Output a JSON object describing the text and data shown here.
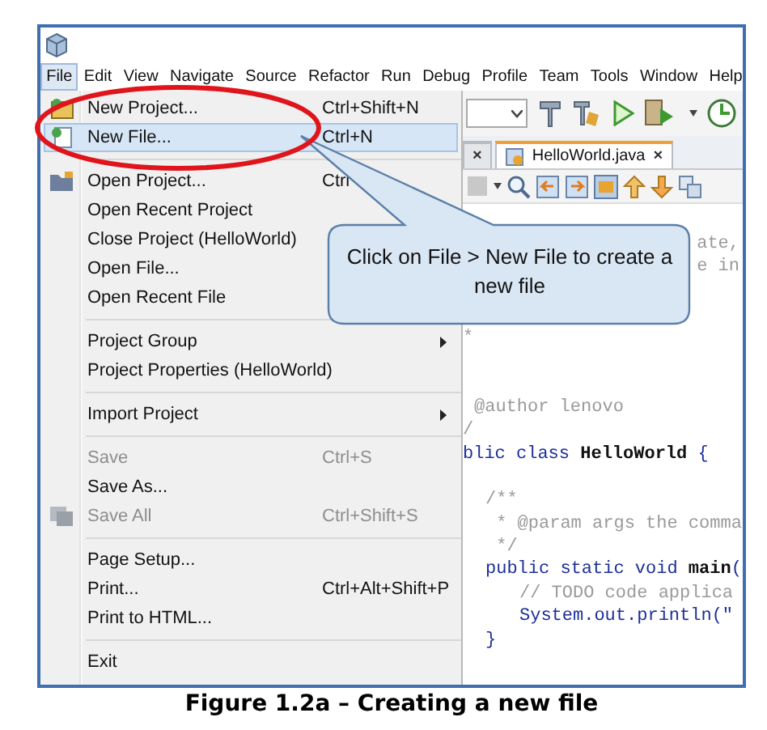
{
  "menubar": [
    {
      "label": "File",
      "selected": true
    },
    {
      "label": "Edit",
      "selected": false
    },
    {
      "label": "View",
      "selected": false
    },
    {
      "label": "Navigate",
      "selected": false
    },
    {
      "label": "Source",
      "selected": false
    },
    {
      "label": "Refactor",
      "selected": false
    },
    {
      "label": "Run",
      "selected": false
    },
    {
      "label": "Debug",
      "selected": false
    },
    {
      "label": "Profile",
      "selected": false
    },
    {
      "label": "Team",
      "selected": false
    },
    {
      "label": "Tools",
      "selected": false
    },
    {
      "label": "Window",
      "selected": false
    },
    {
      "label": "Help",
      "selected": false
    }
  ],
  "file_menu": [
    {
      "kind": "item",
      "label": "New Project...",
      "shortcut": "Ctrl+Shift+N",
      "selected": false,
      "disabled": false
    },
    {
      "kind": "item",
      "label": "New File...",
      "shortcut": "Ctrl+N",
      "selected": true,
      "disabled": false
    },
    {
      "kind": "separator"
    },
    {
      "kind": "item",
      "label": "Open Project...",
      "shortcut": "Ctrl",
      "selected": false,
      "disabled": false
    },
    {
      "kind": "item",
      "label": "Open Recent Project",
      "selected": false,
      "disabled": false
    },
    {
      "kind": "item",
      "label": "Close Project (HelloWorld)",
      "selected": false,
      "disabled": false
    },
    {
      "kind": "item",
      "label": "Open File...",
      "selected": false,
      "disabled": false
    },
    {
      "kind": "item",
      "label": "Open Recent File",
      "selected": false,
      "disabled": false
    },
    {
      "kind": "separator"
    },
    {
      "kind": "item",
      "label": "Project Group",
      "submenu": true,
      "selected": false,
      "disabled": false
    },
    {
      "kind": "item",
      "label": "Project Properties (HelloWorld)",
      "selected": false,
      "disabled": false
    },
    {
      "kind": "separator"
    },
    {
      "kind": "item",
      "label": "Import Project",
      "submenu": true,
      "selected": false,
      "disabled": false
    },
    {
      "kind": "separator"
    },
    {
      "kind": "item",
      "label": "Save",
      "shortcut": "Ctrl+S",
      "selected": false,
      "disabled": true
    },
    {
      "kind": "item",
      "label": "Save As...",
      "selected": false,
      "disabled": false
    },
    {
      "kind": "item",
      "label": "Save All",
      "shortcut": "Ctrl+Shift+S",
      "selected": false,
      "disabled": true
    },
    {
      "kind": "separator"
    },
    {
      "kind": "item",
      "label": "Page Setup...",
      "selected": false,
      "disabled": false
    },
    {
      "kind": "item",
      "label": "Print...",
      "shortcut": "Ctrl+Alt+Shift+P",
      "selected": false,
      "disabled": false
    },
    {
      "kind": "item",
      "label": "Print to HTML...",
      "selected": false,
      "disabled": false
    },
    {
      "kind": "separator"
    },
    {
      "kind": "item",
      "label": "Exit",
      "selected": false,
      "disabled": false
    }
  ],
  "editor_tabs": [
    {
      "close": "×",
      "selected": false
    },
    {
      "label": "HelloWorld.java",
      "close": "×",
      "selected": true
    }
  ],
  "code_lines": [
    {
      "kind": "remnant",
      "text": "ate,"
    },
    {
      "kind": "remnant",
      "text": "e in"
    },
    {
      "kind": "blank"
    },
    {
      "kind": "blank"
    },
    {
      "kind": "comment",
      "text": "*"
    },
    {
      "kind": "blank"
    },
    {
      "kind": "blank"
    },
    {
      "kind": "author",
      "text": "@author lenovo"
    },
    {
      "kind": "comment",
      "text": "/"
    },
    {
      "kind": "declaration",
      "text": "blic class **HelloWorld** {"
    },
    {
      "kind": "blank"
    },
    {
      "kind": "doc",
      "text": "/**"
    },
    {
      "kind": "doc",
      "text": " * @param args the comma"
    },
    {
      "kind": "doc",
      "text": " */"
    },
    {
      "kind": "method",
      "text": "public static void **main**("
    },
    {
      "kind": "todo",
      "text": "// TODO code applica"
    },
    {
      "kind": "statement",
      "text": "System.out.println(\""
    },
    {
      "kind": "method",
      "text": "}"
    }
  ],
  "callout": {
    "text": "Click on File > New File to create a new file"
  },
  "caption": "Figure 1.2a – Creating a new file"
}
